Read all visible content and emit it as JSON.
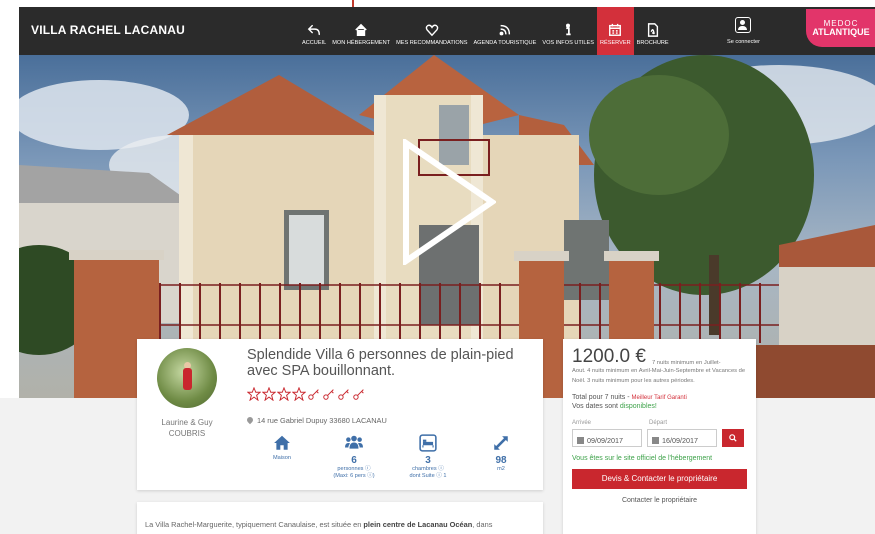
{
  "header": {
    "brand": "VILLA RACHEL LACANAU",
    "nav": [
      {
        "label": "ACCUEIL",
        "icon": "reply-arrow-icon"
      },
      {
        "label": "MON HÉBERGEMENT",
        "icon": "home-icon"
      },
      {
        "label": "MES RECOMMANDATIONS",
        "icon": "heart-icon"
      },
      {
        "label": "AGENDA TOURISTIQUE",
        "icon": "rss-icon"
      },
      {
        "label": "VOS INFOS UTILES",
        "icon": "info-icon"
      },
      {
        "label": "RÉSERVER",
        "icon": "calendar-icon",
        "active": true
      },
      {
        "label": "BROCHURE",
        "icon": "pdf-icon"
      }
    ],
    "login_label": "Se connecter",
    "partner_logo": {
      "line1": "MEDOC",
      "line2": "ATLANTIQUE"
    }
  },
  "owner": {
    "name_line1": "Laurine & Guy",
    "name_line2": "COUBRIS"
  },
  "listing": {
    "title": "Splendide Villa 6 personnes de plain-pied avec SPA bouillonnant.",
    "rating": {
      "stars": 4,
      "keys": 4
    },
    "address": "14 rue Gabriel Dupuy 33680 LACANAU",
    "features": [
      {
        "icon": "house-icon",
        "value": "",
        "line1": "Maison",
        "line2": ""
      },
      {
        "icon": "people-icon",
        "value": "6",
        "line1": "personnes ⓘ",
        "line2": "(Maxi: 6 pers ⓘ)"
      },
      {
        "icon": "bed-icon",
        "value": "3",
        "line1": "chambres ⓘ",
        "line2": "dont Suite ⓘ 1"
      },
      {
        "icon": "expand-icon",
        "value": "98",
        "line1": "m2",
        "line2": ""
      }
    ],
    "description_start": "La Villa Rachel-Marguerite, typiquement Canaulaise, est située en ",
    "description_bold1": "plein centre de Lacanau Océan",
    "description_end": ", dans"
  },
  "booking": {
    "price": "1200.0 €",
    "price_note": "7 nuits minimum en Juillet-",
    "price_note_rest": "Aout. 4 nuits minimum en Avril-Mai-Juin-Septembre et Vacances de Noël. 3 nuits minimum pour les autres périodes.",
    "total_label": "Total pour 7 nuits - ",
    "total_tag": "Meilleur Tarif Garanti",
    "dispo_label": "Vos dates sont ",
    "dispo_value": "disponibles!",
    "arrival_label": "Arrivée",
    "departure_label": "Départ",
    "arrival_date": "09/09/2017",
    "departure_date": "16/09/2017",
    "official_text": "Vous êtes sur le site officiel de l'hébergement",
    "contact_button": "Devis & Contacter le propriétaire",
    "contact_link": "Contacter le propriétaire"
  },
  "colors": {
    "accent": "#c9272e",
    "header": "#2b2b2b",
    "feature": "#3f6fa8",
    "success": "#3ea24a",
    "partner": "#e2356a"
  }
}
